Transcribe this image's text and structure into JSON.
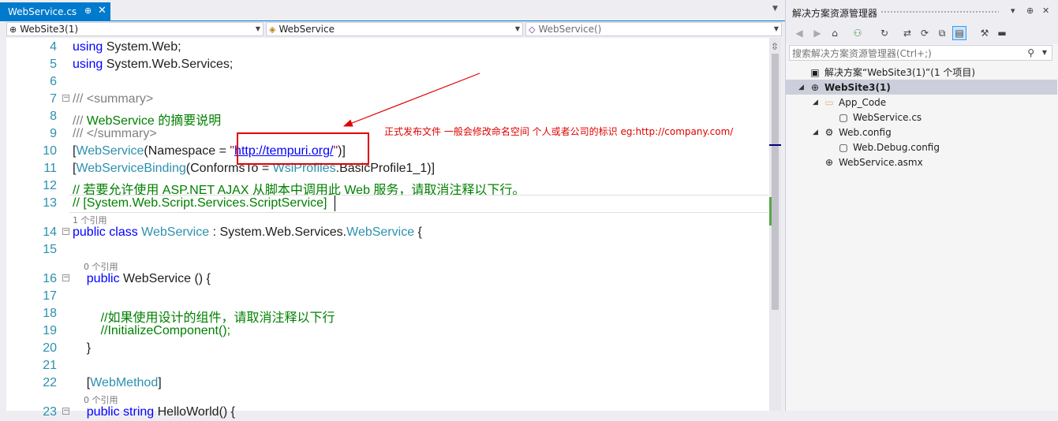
{
  "editor": {
    "tab": {
      "title": "WebService.cs",
      "pin_glyph": "⊕",
      "close_glyph": "✕"
    },
    "nav": {
      "project": "WebSite3(1)",
      "class": "WebService",
      "member": "WebService()"
    },
    "lines": [
      {
        "num": "4",
        "parts": [
          [
            "kw",
            "using"
          ],
          [
            "",
            " System.Web;"
          ]
        ]
      },
      {
        "num": "5",
        "parts": [
          [
            "kw",
            "using"
          ],
          [
            "",
            " System.Web.Services;"
          ]
        ]
      },
      {
        "num": "6",
        "parts": []
      },
      {
        "num": "7",
        "parts": [
          [
            "gr",
            "/// <summary>"
          ]
        ],
        "fold": "−"
      },
      {
        "num": "8",
        "parts": [
          [
            "gr",
            "/// "
          ],
          [
            "cm",
            "WebService 的摘要说明"
          ]
        ]
      },
      {
        "num": "9",
        "parts": [
          [
            "gr",
            "/// </summary>"
          ]
        ]
      },
      {
        "num": "10",
        "parts": [
          [
            "",
            "["
          ],
          [
            "ty",
            "WebService"
          ],
          [
            "",
            "(Namespace = "
          ],
          [
            "str",
            "\""
          ],
          [
            "url",
            "http://tempuri.org/"
          ],
          [
            "str",
            "\""
          ],
          [
            "",
            ")]"
          ]
        ]
      },
      {
        "num": "11",
        "parts": [
          [
            "",
            "["
          ],
          [
            "ty",
            "WebServiceBinding"
          ],
          [
            "",
            "(ConformsTo = "
          ],
          [
            "ty",
            "WsiProfiles"
          ],
          [
            "",
            ".BasicProfile1_1)]"
          ]
        ]
      },
      {
        "num": "12",
        "parts": [
          [
            "cm",
            "// 若要允许使用 ASP.NET AJAX 从脚本中调用此 Web 服务，请取消注释以下行。"
          ]
        ]
      },
      {
        "num": "13",
        "parts": [
          [
            "cm",
            "// [System.Web.Script.Services.ScriptService]"
          ]
        ]
      },
      {
        "num": "14",
        "parts": [
          [
            "kw",
            "public"
          ],
          [
            "",
            " "
          ],
          [
            "kw",
            "class"
          ],
          [
            "",
            " "
          ],
          [
            "ty",
            "WebService"
          ],
          [
            "",
            " : System.Web.Services."
          ],
          [
            "ty",
            "WebService"
          ],
          [
            "",
            " {"
          ]
        ],
        "fold": "−",
        "lens": "1 个引用"
      },
      {
        "num": "15",
        "parts": []
      },
      {
        "num": "16",
        "parts": [
          [
            "",
            "    "
          ],
          [
            "kw",
            "public"
          ],
          [
            "",
            " WebService () {"
          ]
        ],
        "fold": "−",
        "lens": "    0 个引用"
      },
      {
        "num": "17",
        "parts": []
      },
      {
        "num": "18",
        "parts": [
          [
            "",
            "        "
          ],
          [
            "cm",
            "//如果使用设计的组件，请取消注释以下行"
          ]
        ]
      },
      {
        "num": "19",
        "parts": [
          [
            "",
            "        "
          ],
          [
            "cm",
            "//InitializeComponent();"
          ]
        ]
      },
      {
        "num": "20",
        "parts": [
          [
            "",
            "    }"
          ]
        ]
      },
      {
        "num": "21",
        "parts": []
      },
      {
        "num": "22",
        "parts": [
          [
            "",
            "    ["
          ],
          [
            "ty",
            "WebMethod"
          ],
          [
            "",
            "]"
          ]
        ]
      },
      {
        "num": "23",
        "parts": [
          [
            "",
            "    "
          ],
          [
            "kw",
            "public"
          ],
          [
            "",
            " "
          ],
          [
            "kw",
            "string"
          ],
          [
            "",
            " HelloWorld() {"
          ]
        ],
        "fold": "−",
        "lens": "    0 个引用"
      }
    ],
    "annotation": "正式发布文件 一般会修改命名空间 个人或者公司的标识 eg:http://company.com/"
  },
  "solution_explorer": {
    "title": "解决方案资源管理器",
    "title_buttons": [
      "▾",
      "⊕",
      "✕"
    ],
    "search_placeholder": "搜索解决方案资源管理器(Ctrl+;)",
    "tree": [
      {
        "label": "解决方案“WebSite3(1)”(1 个项目)",
        "icon": "solution-icon",
        "glyph": "▣",
        "level": 0,
        "expander": "",
        "bold": false
      },
      {
        "label": "WebSite3(1)",
        "icon": "website-globe-icon",
        "glyph": "⊕",
        "level": 0,
        "expander": "◢",
        "bold": true,
        "selected": true
      },
      {
        "label": "App_Code",
        "icon": "folder-icon",
        "glyph": "▭",
        "level": 1,
        "expander": "◢",
        "bold": false
      },
      {
        "label": "WebService.cs",
        "icon": "cs-file-icon",
        "glyph": "▢",
        "level": 2,
        "expander": "",
        "bold": false
      },
      {
        "label": "Web.config",
        "icon": "config-file-icon",
        "glyph": "⚙",
        "level": 1,
        "expander": "◢",
        "bold": false
      },
      {
        "label": "Web.Debug.config",
        "icon": "config-file-icon",
        "glyph": "▢",
        "level": 2,
        "expander": "",
        "bold": false
      },
      {
        "label": "WebService.asmx",
        "icon": "asmx-file-icon",
        "glyph": "⊕",
        "level": 1,
        "expander": "",
        "bold": false
      }
    ]
  }
}
